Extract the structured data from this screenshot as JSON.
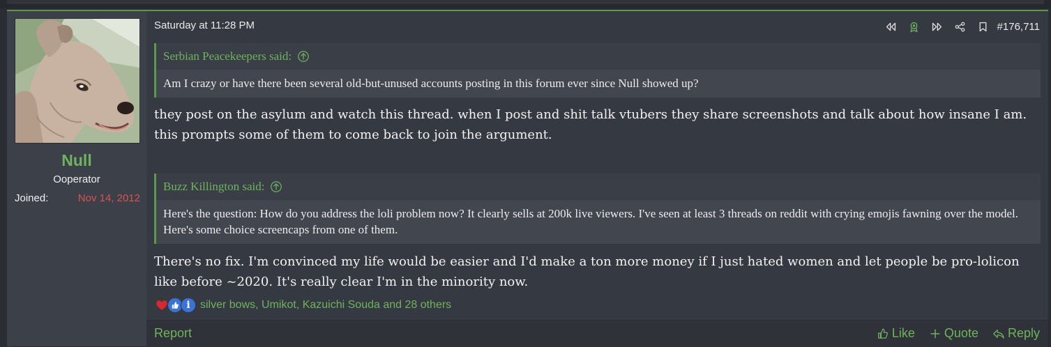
{
  "user": {
    "name": "Null",
    "title": "Ooperator",
    "joined_label": "Joined:",
    "joined_date": "Nov 14, 2012"
  },
  "post": {
    "date": "Saturday at 11:28 PM",
    "number": "#176,711",
    "quotes": [
      {
        "author": "Serbian Peacekeepers said:",
        "body": "Am I crazy or have there been several old-but-unused accounts posting in this forum ever since Null showed up?"
      },
      {
        "author": "Buzz Killington said:",
        "body": "Here's the question: How do you address the loli problem now? It clearly sells at 200k live viewers. I've seen at least 3 threads on reddit with crying emojis fawning over the model. Here's some choice screencaps from one of them."
      }
    ],
    "replies": [
      "they post on the asylum and watch this thread. when I post and shit talk vtubers they share screenshots and talk about how insane I am. this prompts some of them to come back to join the argument.",
      "There's no fix. I'm convinced my life would be easier and I'd make a ton more money if I just hated women and let people be pro-lolicon like before ~2020. It's really clear I'm in the minority now."
    ]
  },
  "reactions": {
    "icons": [
      "heart-icon",
      "thumbs-up-icon",
      "informative-icon"
    ],
    "users_text": "silver bows, Umikot, Kazuichi Souda and 28 others"
  },
  "footer": {
    "report": "Report",
    "like": "Like",
    "quote": "Quote",
    "reply": "Reply"
  },
  "colors": {
    "accent": "#6fb35c",
    "joined_date": "#d9534f",
    "background": "#353941"
  }
}
